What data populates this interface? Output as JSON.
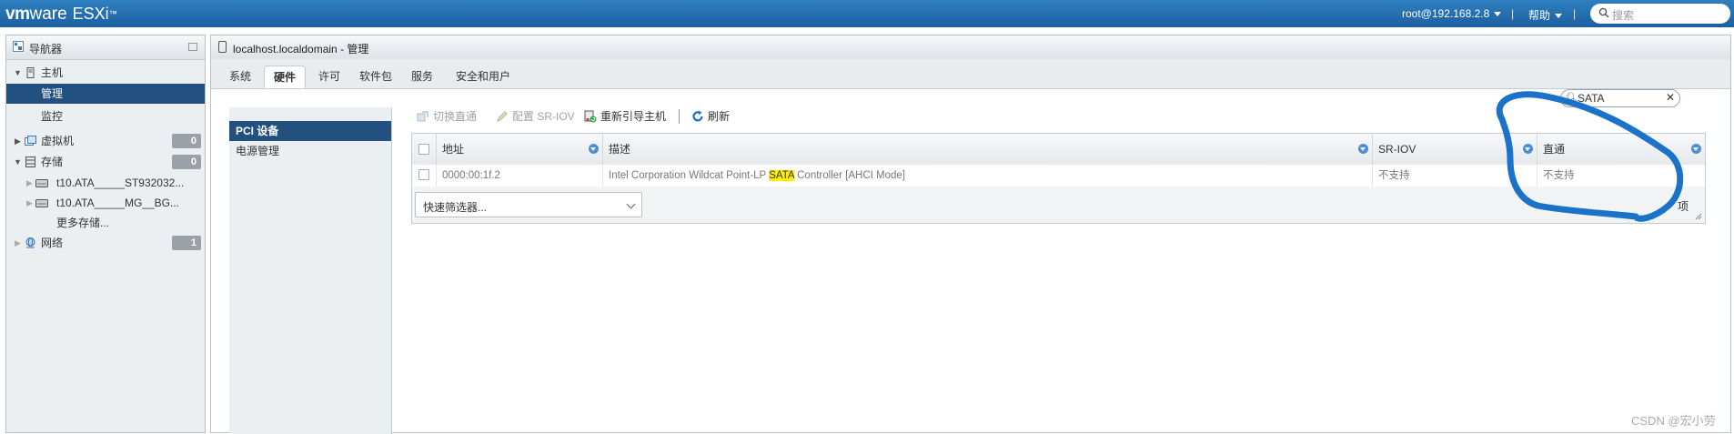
{
  "topbar": {
    "logo_vm": "vm",
    "logo_ware": "ware",
    "logo_product": "ESXi",
    "logo_tm": "™",
    "user": "root@192.168.2.8",
    "help": "帮助",
    "separator": "|",
    "search_placeholder": "搜索"
  },
  "navigator": {
    "title": "导航器",
    "items": [
      {
        "label": "主机"
      },
      {
        "label": "管理"
      },
      {
        "label": "监控"
      },
      {
        "label": "虚拟机",
        "badge": "0"
      },
      {
        "label": "存储",
        "badge": "0"
      },
      {
        "label": "t10.ATA_____ST932032..."
      },
      {
        "label": "t10.ATA_____MG__BG..."
      },
      {
        "label": "更多存储..."
      },
      {
        "label": "网络",
        "badge": "1"
      }
    ]
  },
  "main": {
    "title": "localhost.localdomain - 管理",
    "tabs": [
      "系统",
      "硬件",
      "许可",
      "软件包",
      "服务",
      "安全和用户"
    ],
    "active_tab": "硬件",
    "subnav": [
      "PCI 设备",
      "电源管理"
    ],
    "toolbar": {
      "toggle_passthrough": "切换直通",
      "configure_sriov": "配置 SR-IOV",
      "reboot_host": "重新引导主机",
      "refresh": "刷新"
    },
    "filter": {
      "value": "SATA",
      "clear": "✕"
    },
    "table": {
      "columns": [
        "地址",
        "描述",
        "SR-IOV",
        "直通"
      ],
      "rows": [
        {
          "address": "0000:00:1f.2",
          "description_pre": "Intel Corporation Wildcat Point-LP ",
          "description_hl": "SATA",
          "description_post": " Controller [AHCI Mode]",
          "sriov": "不支持",
          "passthrough": "不支持"
        }
      ],
      "quick_filter": "快速筛选器...",
      "items_label": "项"
    }
  },
  "watermark": "CSDN @宏小劳",
  "colors": {
    "topbar": "#1c5f9f",
    "selected": "#22507f",
    "annotation": "#1a73c8",
    "highlight": "#ffee00"
  }
}
